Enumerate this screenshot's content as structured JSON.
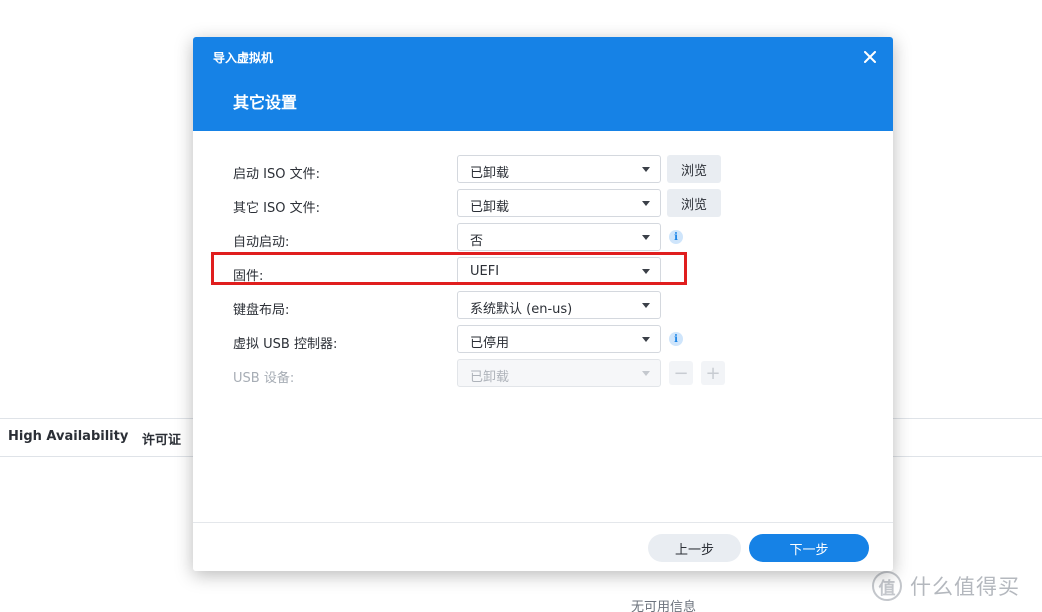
{
  "background": {
    "tabs": [
      "High Availability",
      "许可证"
    ],
    "empty_text": "无可用信息",
    "watermark_logo": "值",
    "watermark_text": "什么值得买"
  },
  "dialog": {
    "title": "导入虚拟机",
    "step_title": "其它设置",
    "close_icon": "close-icon",
    "rows": [
      {
        "label": "启动 ISO 文件:",
        "value": "已卸载",
        "action": "浏览",
        "disabled": false
      },
      {
        "label": "其它 ISO 文件:",
        "value": "已卸载",
        "action": "浏览",
        "disabled": false
      },
      {
        "label": "自动启动:",
        "value": "否",
        "info": "i",
        "disabled": false
      },
      {
        "label": "固件:",
        "value": "UEFI",
        "highlighted": true,
        "disabled": false
      },
      {
        "label": "键盘布局:",
        "value": "系统默认 (en-us)",
        "disabled": false
      },
      {
        "label": "虚拟 USB 控制器:",
        "value": "已停用",
        "info": "i",
        "disabled": false
      },
      {
        "label": "USB 设备:",
        "value": "已卸载",
        "disabled": true,
        "minus": "−",
        "plus": "+"
      }
    ],
    "footer": {
      "prev_label": "上一步",
      "next_label": "下一步"
    },
    "colors": {
      "header": "#1682e6",
      "highlight": "#e01e1e"
    }
  }
}
